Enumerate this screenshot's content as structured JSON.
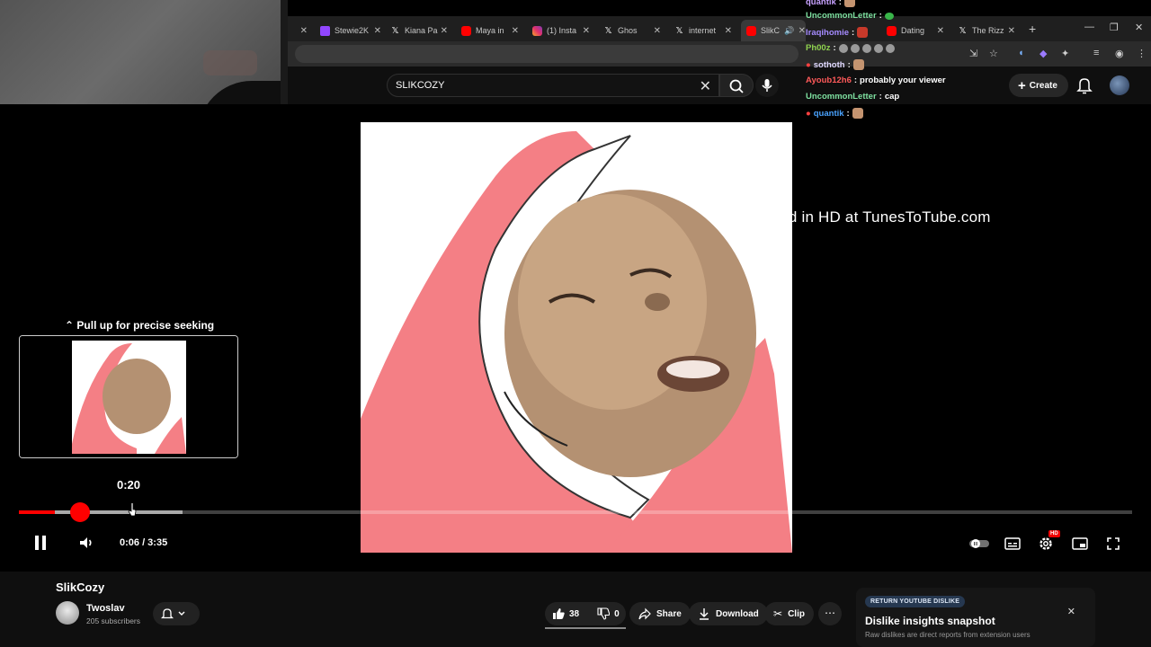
{
  "tabs": [
    {
      "label": "Stewie2K",
      "icon_color": "#9146ff",
      "icon": "twitch-icon"
    },
    {
      "label": "Kiana Pa",
      "icon_color": "#ffffff",
      "icon": "x-icon"
    },
    {
      "label": "Maya in",
      "icon_color": "#ff0000",
      "icon": "youtube-icon"
    },
    {
      "label": "(1) Insta",
      "icon_color": "#e1306c",
      "icon": "instagram-icon"
    },
    {
      "label": "Ghos",
      "icon_color": "#ffffff",
      "icon": "x-icon"
    },
    {
      "label": "internet",
      "icon_color": "#ffffff",
      "icon": "x-icon"
    },
    {
      "label": "SlikC",
      "icon_color": "#ff0000",
      "icon": "youtube-icon",
      "active": true
    },
    {
      "label": "Dating",
      "icon_color": "#ff0000",
      "icon": "youtube-icon"
    },
    {
      "label": "The Rizz",
      "icon_color": "#ffffff",
      "icon": "x-icon"
    }
  ],
  "search": {
    "value": "SLIKCOZY"
  },
  "masthead": {
    "create_label": "Create"
  },
  "watermark": "uploaded in HD at TunesToTube.com",
  "chat": [
    {
      "user": "quantik",
      "color": "#c8a2ff",
      "text": "",
      "emote": "skin"
    },
    {
      "user": "UncommonLetter",
      "color": "#7ee0a0",
      "text": "",
      "emote": "green"
    },
    {
      "user": "Iraqihomie",
      "color": "#a58bff",
      "text": "",
      "emote": "red"
    },
    {
      "user": "Ph00z",
      "color": "#8fd14f",
      "text": "",
      "emote": "fist"
    },
    {
      "user": "sothoth",
      "color": "#e0d9ff",
      "text": "",
      "emote": "skin"
    },
    {
      "user": "Ayoub12h6",
      "color": "#ff5a5a",
      "text": "probably your viewer",
      "emote": ""
    },
    {
      "user": "UncommonLetter",
      "color": "#7ee0a0",
      "text": "cap",
      "emote": ""
    },
    {
      "user": "quantik",
      "color": "#4aa3ff",
      "text": "",
      "emote": "skin"
    }
  ],
  "player": {
    "seek_hint": "Pull up for precise seeking",
    "seek_preview_time": "0:20",
    "current_time": "0:06",
    "duration": "3:35",
    "time_display": "0:06 / 3:35",
    "played_fraction": 0.032,
    "buffered_fraction": 0.147,
    "hover_fraction": 0.099,
    "hd_badge": "HD"
  },
  "video": {
    "title": "SlikCozy",
    "channel": "Twoslav",
    "subscribers": "205 subscribers",
    "likes": "38",
    "dislikes": "0",
    "share_label": "Share",
    "download_label": "Download",
    "clip_label": "Clip"
  },
  "ryd": {
    "badge": "RETURN YOUTUBE DISLIKE",
    "title": "Dislike insights snapshot",
    "subtitle": "Raw dislikes are direct reports from extension users"
  },
  "colors": {
    "accent": "#ff0000",
    "background": "#0f0f0f"
  }
}
